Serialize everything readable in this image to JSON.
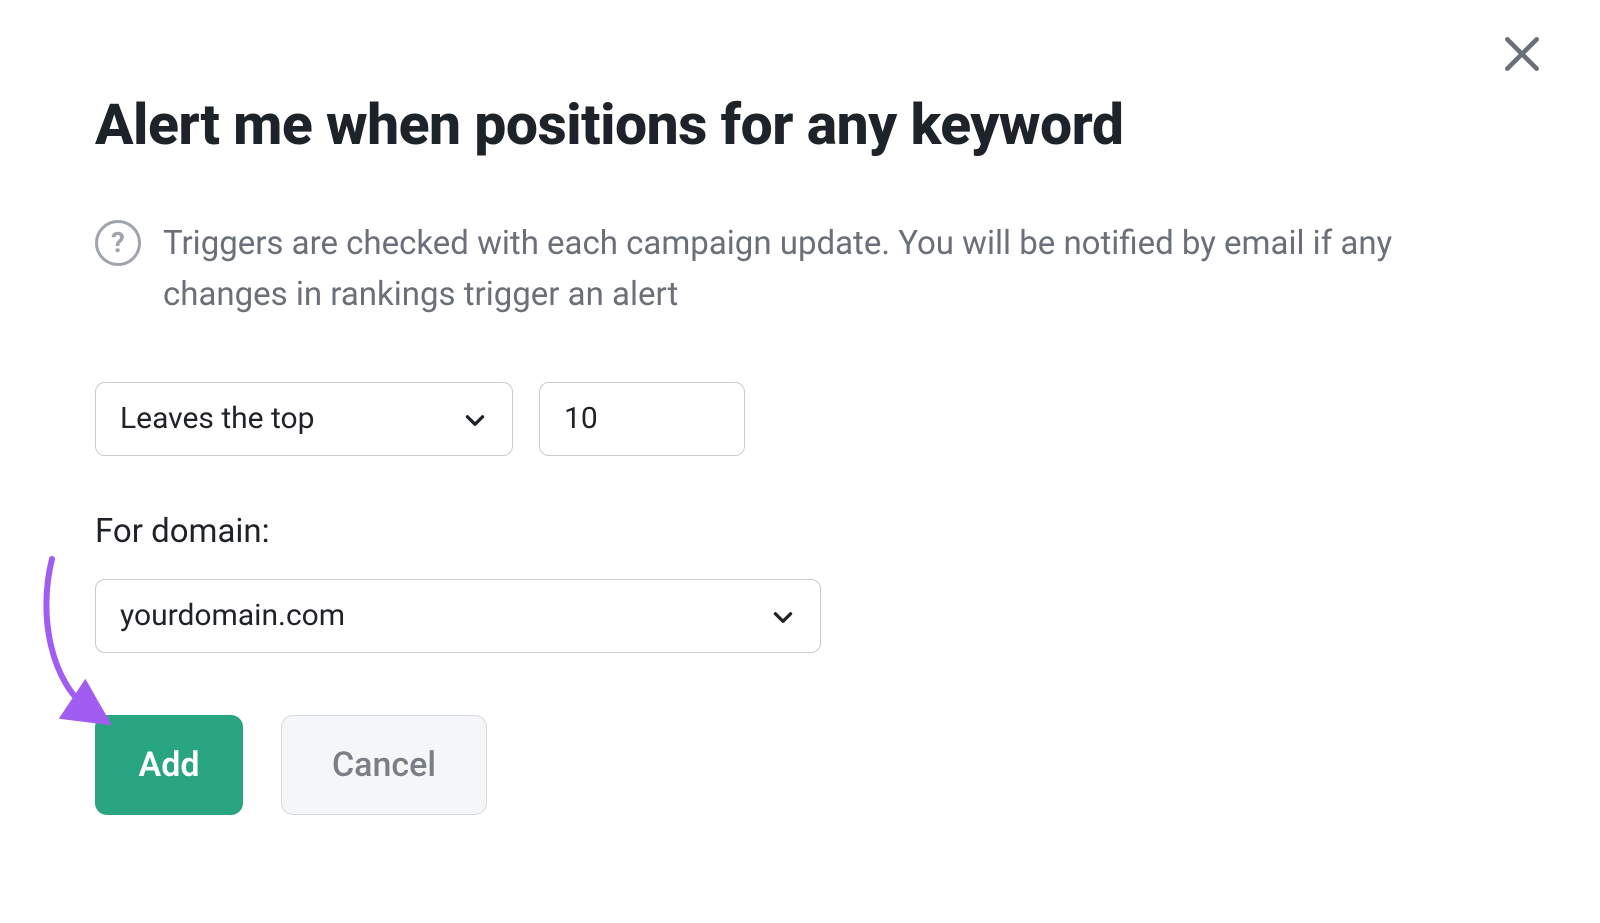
{
  "dialog": {
    "title": "Alert me when positions for any keyword",
    "help_text": "Triggers are checked with each campaign update. You will be notified by email if any changes in rankings trigger an alert",
    "condition": {
      "selected": "Leaves the top",
      "threshold": "10"
    },
    "domain": {
      "label": "For domain:",
      "selected": "yourdomain.com"
    },
    "buttons": {
      "add": "Add",
      "cancel": "Cancel"
    }
  }
}
